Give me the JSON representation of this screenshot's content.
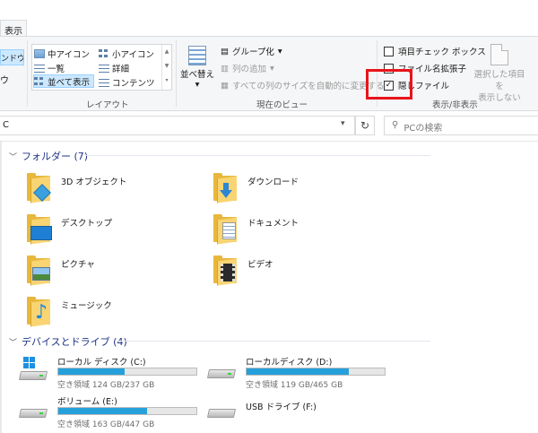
{
  "ribbon": {
    "active_tab": "表示",
    "leading_cut": {
      "button": "ンドウ",
      "glyph": "ウ"
    },
    "layout_group": {
      "label": "レイアウト",
      "items": [
        {
          "label": "中アイコン",
          "icon": "large-icons-icon"
        },
        {
          "label": "小アイコン",
          "icon": "small-icons-icon"
        },
        {
          "label": "一覧",
          "icon": "list-icon"
        },
        {
          "label": "詳細",
          "icon": "details-icon"
        },
        {
          "label": "並べて表示",
          "icon": "tiles-icon",
          "selected": true
        },
        {
          "label": "コンテンツ",
          "icon": "content-icon"
        }
      ]
    },
    "current_view_group": {
      "label": "現在のビュー",
      "sort_label_1": "並べ替え",
      "sort_label_2": "▾",
      "group_by": "グループ化",
      "add_column": "列の追加",
      "autofit": "すべての列のサイズを自動的に変更する"
    },
    "show_hide_group": {
      "label": "表示/非表示",
      "item_checkboxes": "項目チェック ボックス",
      "file_extensions": "ファイル名拡張子",
      "hidden_files": "隠しファイル",
      "hide_selected_1": "選択した項目を",
      "hide_selected_2": "表示しない"
    }
  },
  "address": {
    "path_fragment": "C",
    "refresh_glyph": "↻",
    "search_placeholder": "PCの検索"
  },
  "folders_section": {
    "title": "フォルダー (7)",
    "items": [
      {
        "name": "3D オブジェクト"
      },
      {
        "name": "ダウンロード"
      },
      {
        "name": "デスクトップ"
      },
      {
        "name": "ドキュメント"
      },
      {
        "name": "ピクチャ"
      },
      {
        "name": "ビデオ"
      },
      {
        "name": "ミュージック"
      }
    ]
  },
  "drives_section": {
    "title": "デバイスとドライブ (4)",
    "items": [
      {
        "name": "ローカル ディスク (C:)",
        "free": "空き領域 124 GB/237 GB",
        "used_fraction": 0.48
      },
      {
        "name": "ローカルディスク (D:)",
        "free": "空き領域 119 GB/465 GB",
        "used_fraction": 0.74
      },
      {
        "name": "ボリューム (E:)",
        "free": "空き領域 163 GB/447 GB",
        "used_fraction": 0.64
      },
      {
        "name": "USB ドライブ (F:)",
        "free": ""
      }
    ]
  },
  "colors": {
    "accent": "#26a0da",
    "highlight": "#e8141a",
    "section_title": "#1e3287",
    "folder": "#f9d472"
  }
}
